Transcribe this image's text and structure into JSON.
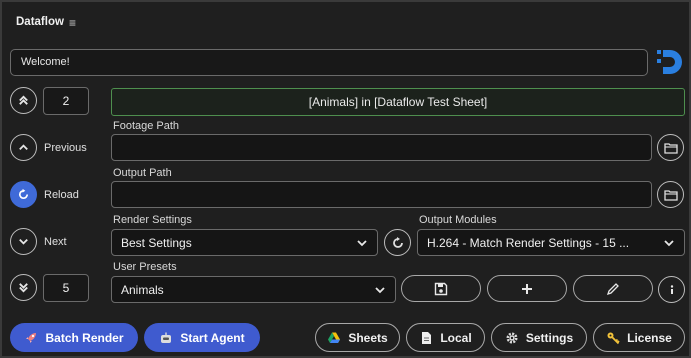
{
  "app": {
    "title": "Dataflow"
  },
  "welcome": {
    "text": "Welcome!"
  },
  "banner": {
    "text": "[Animals] in [Dataflow Test Sheet]"
  },
  "nav": {
    "top_value": "2",
    "bottom_value": "5",
    "previous_label": "Previous",
    "reload_label": "Reload",
    "next_label": "Next"
  },
  "footage": {
    "label": "Footage Path",
    "value": ""
  },
  "output": {
    "label": "Output Path",
    "value": ""
  },
  "render_settings": {
    "label": "Render Settings",
    "selected": "Best Settings"
  },
  "output_modules": {
    "label": "Output Modules",
    "selected": "H.264 - Match Render Settings - 15 ..."
  },
  "user_presets": {
    "label": "User Presets",
    "selected": "Animals"
  },
  "footer": {
    "batch_render": "Batch Render",
    "start_agent": "Start Agent",
    "sheets": "Sheets",
    "local": "Local",
    "settings": "Settings",
    "license": "License"
  },
  "colors": {
    "accent": "#3f5bcf",
    "banner_border": "#4e8f4e",
    "reload_blue": "#3f6ad8",
    "logo": "#2a7fe0"
  },
  "icons": [
    "menu-icon",
    "double-chevron-up-icon",
    "chevron-up-icon",
    "reload-icon",
    "chevron-down-icon",
    "double-chevron-down-icon",
    "folder-icon",
    "refresh-icon",
    "save-icon",
    "plus-icon",
    "pencil-icon",
    "info-icon",
    "rocket-icon",
    "robot-icon",
    "google-drive-icon",
    "file-icon",
    "gear-icon",
    "key-icon"
  ]
}
